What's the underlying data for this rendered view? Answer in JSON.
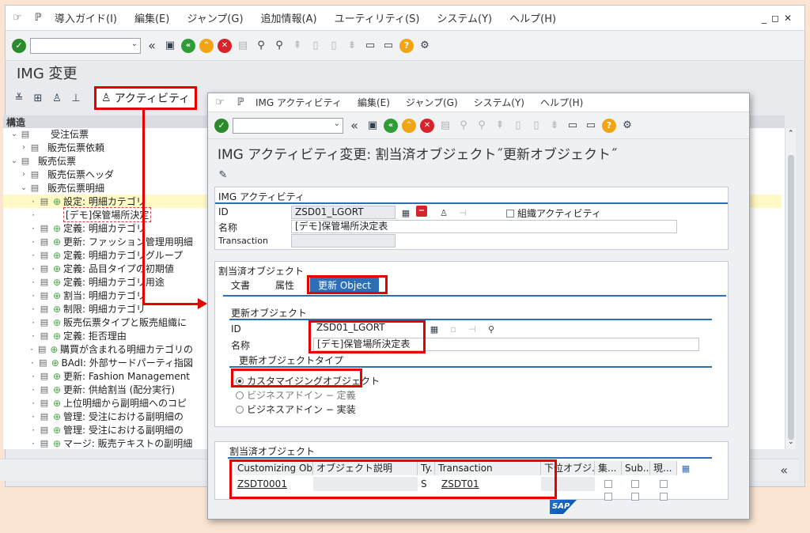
{
  "main": {
    "menu": [
      "導入ガイド(I)",
      "編集(E)",
      "ジャンプ(G)",
      "追加情報(A)",
      "ユーティリティ(S)",
      "システム(Y)",
      "ヘルプ(H)"
    ],
    "title": "IMG 変更",
    "activity_button": "アクティビティ",
    "tree_header": "構造",
    "tree": [
      {
        "label": "受注伝票",
        "type": "node"
      },
      {
        "label": "販売伝票依頼",
        "type": "node"
      },
      {
        "label": "販売伝票",
        "type": "node"
      },
      {
        "label": "販売伝票ヘッダ",
        "type": "node"
      },
      {
        "label": "販売伝票明細",
        "type": "node"
      },
      {
        "label": "設定: 明細カテゴリ",
        "type": "act"
      },
      {
        "label": "[デモ]保管場所決定",
        "type": "note"
      },
      {
        "label": "定義: 明細カテゴリ",
        "type": "act"
      },
      {
        "label": "更新: ファッション管理用明細",
        "type": "act"
      },
      {
        "label": "定義: 明細カテゴリグループ",
        "type": "act"
      },
      {
        "label": "定義: 品目タイプの初期値",
        "type": "act"
      },
      {
        "label": "定義: 明細カテゴリ用途",
        "type": "act"
      },
      {
        "label": "割当: 明細カテゴリ",
        "type": "act"
      },
      {
        "label": "制限: 明細カテゴリ",
        "type": "act"
      },
      {
        "label": "販売伝票タイプと販売組織に",
        "type": "act"
      },
      {
        "label": "定義: 拒否理由",
        "type": "act"
      },
      {
        "label": "購買が含まれる明細カテゴリの",
        "type": "act"
      },
      {
        "label": "BAdI: 外部サードパーティ指図",
        "type": "act"
      },
      {
        "label": "更新: Fashion Management",
        "type": "act"
      },
      {
        "label": "更新: 供給割当 (配分実行)",
        "type": "act"
      },
      {
        "label": "上位明細から副明細へのコピ",
        "type": "act"
      },
      {
        "label": "管理: 受注における副明細の",
        "type": "act"
      },
      {
        "label": "管理: 受注における副明細の",
        "type": "act"
      },
      {
        "label": "マージ: 販売テキストの副明細",
        "type": "act"
      }
    ]
  },
  "popup": {
    "menu": [
      "IMG アクティビティ",
      "編集(E)",
      "ジャンプ(G)",
      "システム(Y)",
      "ヘルプ(H)"
    ],
    "title": "IMG アクティビティ変更: 割当済オブジェクト˝更新オブジェクト˝",
    "img_activity": {
      "group_title": "IMG アクティビティ",
      "id_label": "ID",
      "id_value": "ZSD01_LGORT",
      "name_label": "名称",
      "name_value": "[デモ]保管場所決定表",
      "transaction_label": "Transaction",
      "org_activity_label": "組織アクティビティ"
    },
    "assigned": {
      "group_title": "割当済オブジェクト",
      "tabs": [
        "文書",
        "属性",
        "更新 Object"
      ]
    },
    "update_object": {
      "group_title": "更新オブジェクト",
      "id_label": "ID",
      "id_value": "ZSD01_LGORT",
      "name_label": "名称",
      "name_value": "[デモ]保管場所決定表",
      "type_title": "更新オブジェクトタイプ",
      "radios": [
        "カスタマイジングオブジェクト",
        "ビジネスアドイン − 定義",
        "ビジネスアドイン − 実装"
      ]
    },
    "assigned_table": {
      "group_title": "割当済オブジェクト",
      "headers": [
        "Customizing Obj...",
        "オブジェクト説明",
        "Ty.",
        "Transaction",
        "下位オブジ...",
        "集...",
        "Sub...",
        "現..."
      ],
      "rows": [
        {
          "obj": "ZSDT0001",
          "desc": "",
          "ty": "S",
          "transaction": "ZSDT01"
        }
      ]
    },
    "sap_logo": "SAP"
  }
}
